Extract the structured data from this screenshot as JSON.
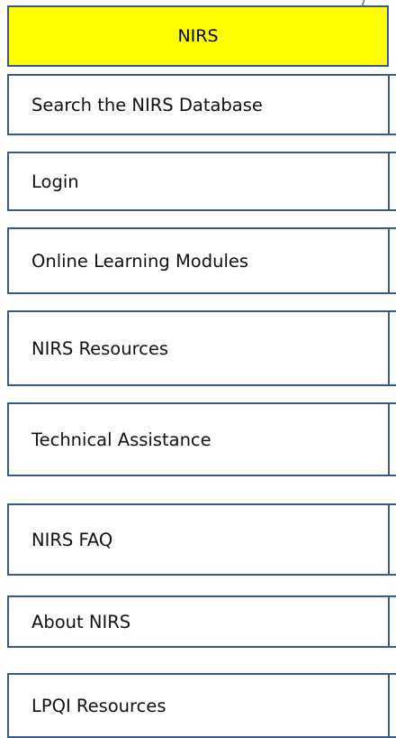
{
  "header": {
    "title": "NIRS",
    "background": "#ffff00",
    "border_color": "#3a5a8c"
  },
  "menu": {
    "items": [
      {
        "label": "Search the NIRS Database"
      },
      {
        "label": "Login"
      },
      {
        "label": "Online Learning Modules"
      },
      {
        "label": "NIRS Resources"
      },
      {
        "label": "Technical Assistance"
      },
      {
        "label": "NIRS FAQ"
      },
      {
        "label": "About NIRS"
      },
      {
        "label": "LPQI Resources"
      }
    ]
  }
}
